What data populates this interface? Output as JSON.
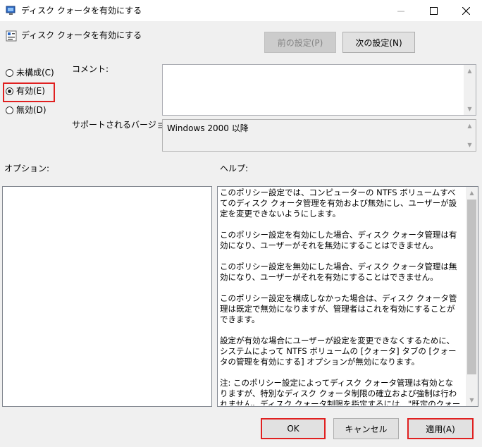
{
  "window": {
    "title": "ディスク クォータを有効にする",
    "minimize_glyph": "—",
    "maximize_glyph": "☐",
    "close_glyph": "✕"
  },
  "header": {
    "policy_name": "ディスク クォータを有効にする",
    "prev_button": "前の設定(P)",
    "next_button": "次の設定(N)"
  },
  "state": {
    "options": [
      {
        "label": "未構成(C)",
        "selected": false
      },
      {
        "label": "有効(E)",
        "selected": true
      },
      {
        "label": "無効(D)",
        "selected": false
      }
    ]
  },
  "comment": {
    "label": "コメント:",
    "value": ""
  },
  "supported": {
    "label": "サポートされるバージョン:",
    "value": "Windows 2000 以降"
  },
  "options_label": "オプション:",
  "help": {
    "label": "ヘルプ:",
    "paragraphs": [
      "このポリシー設定では、コンピューターの NTFS ボリュームすべてのディスク クォータ管理を有効および無効にし、ユーザーが設定を変更できないようにします。",
      "このポリシー設定を有効にした場合、ディスク クォータ管理は有効になり、ユーザーがそれを無効にすることはできません。",
      "このポリシー設定を無効にした場合、ディスク クォータ管理は無効になり、ユーザーがそれを有効にすることはできません。",
      "このポリシー設定を構成しなかった場合は、ディスク クォータ管理は既定で無効になりますが、管理者はこれを有効にすることができます。",
      "設定が有効な場合にユーザーが設定を変更できなくするために、システムによって NTFS ボリュームの [クォータ] タブの [クォータの管理を有効にする] オプションが無効になります。",
      "注: このポリシー設定によってディスク クォータ管理は有効となりますが、特別なディスク クォータ制限の確立および強制は行われません。ディスク クォータ制限を指定するには、\"既定のクォータ制限および警告レベル\" ポリシー設定を使用してください。それ以外の場合は、クォータ制限としてボリューム上の空き容量が使用されます。"
    ]
  },
  "footer": {
    "ok": "OK",
    "cancel": "キャンセル",
    "apply": "適用(A)"
  },
  "colors": {
    "highlight": "#e02020",
    "scroll_thumb": "#c1c1c1"
  }
}
